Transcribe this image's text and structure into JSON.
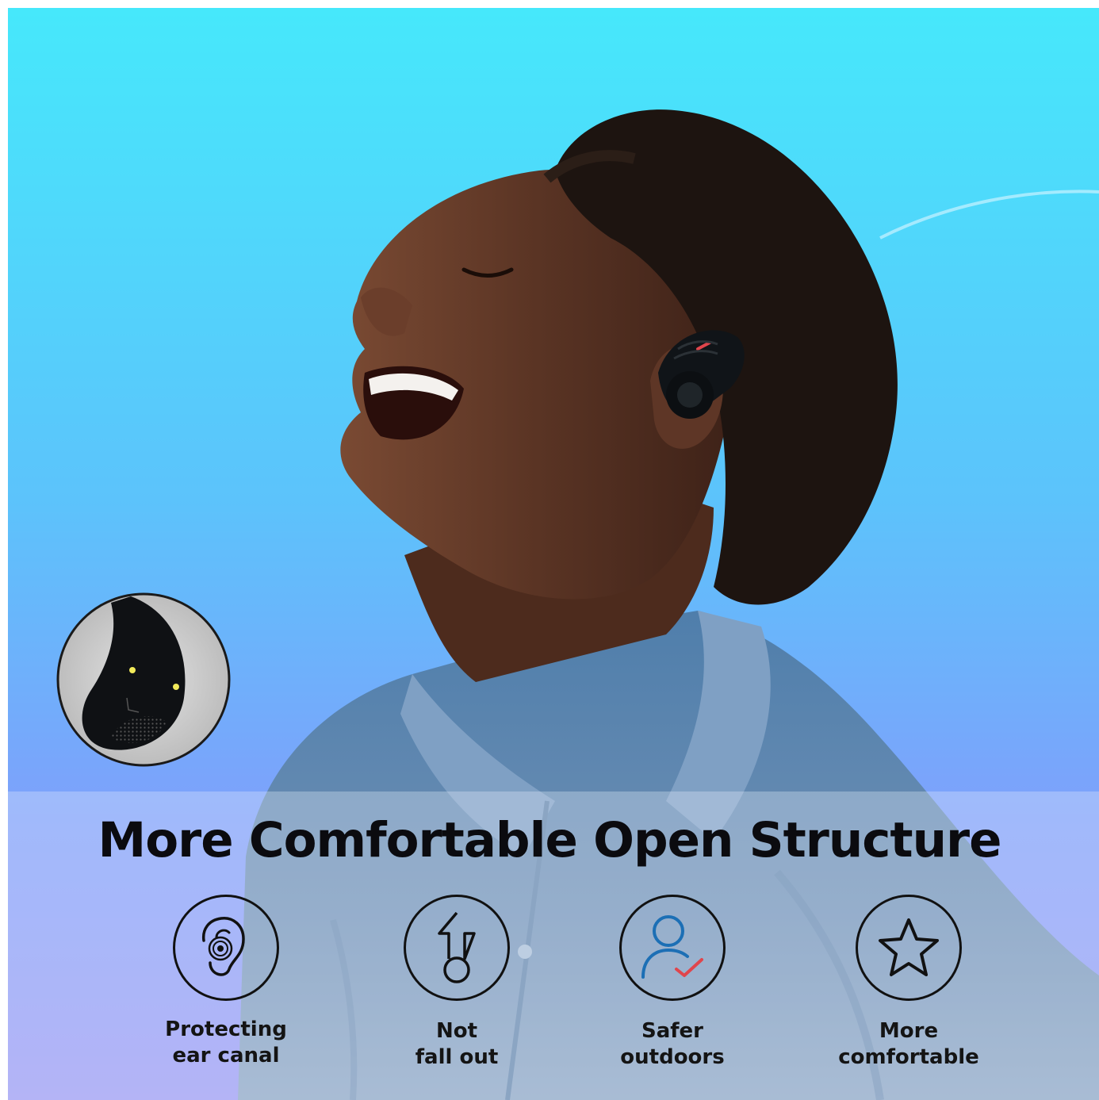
{
  "headline": "More Comfortable Open Structure",
  "features": [
    {
      "icon": "ear-icon",
      "line1": "Protecting",
      "line2": "ear canal"
    },
    {
      "icon": "arrow-up-icon",
      "line1": "Not",
      "line2": "fall out"
    },
    {
      "icon": "person-check-icon",
      "line1": "Safer",
      "line2": "outdoors"
    },
    {
      "icon": "star-icon",
      "line1": "More",
      "line2": "comfortable"
    }
  ],
  "colors": {
    "sky_top": "#46e8fb",
    "sky_bottom": "#8f8dfb",
    "shirt": "#6d8fb4",
    "skin": "#5a3424",
    "hair": "#1d1410",
    "earbud": "#101418",
    "accent_blue": "#1c6fb5",
    "accent_red": "#e0454c"
  }
}
